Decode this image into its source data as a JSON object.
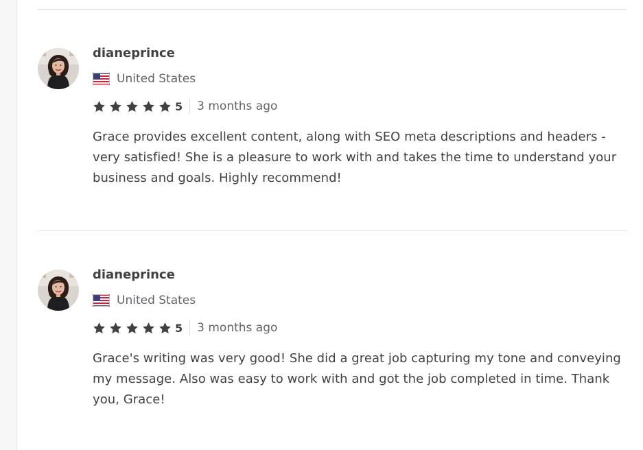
{
  "colors": {
    "text_primary": "#404145",
    "text_secondary": "#62646a",
    "divider": "#dadbdd",
    "star": "#404145"
  },
  "reviews": [
    {
      "username": "dianeprince",
      "country": "United States",
      "flag_icon": "us-flag-icon",
      "rating": "5",
      "stars": 5,
      "time": "3 months ago",
      "text": "Grace provides excellent content, along with SEO meta descriptions and headers - very satisfied! She is a pleasure to work with and takes the time to understand your business and goals. Highly recommend!"
    },
    {
      "username": "dianeprince",
      "country": "United States",
      "flag_icon": "us-flag-icon",
      "rating": "5",
      "stars": 5,
      "time": "3 months ago",
      "text": "Grace's writing was very good! She did a great job capturing my tone and conveying my message. Also was easy to work with and got the job completed in time. Thank you, Grace!"
    }
  ]
}
